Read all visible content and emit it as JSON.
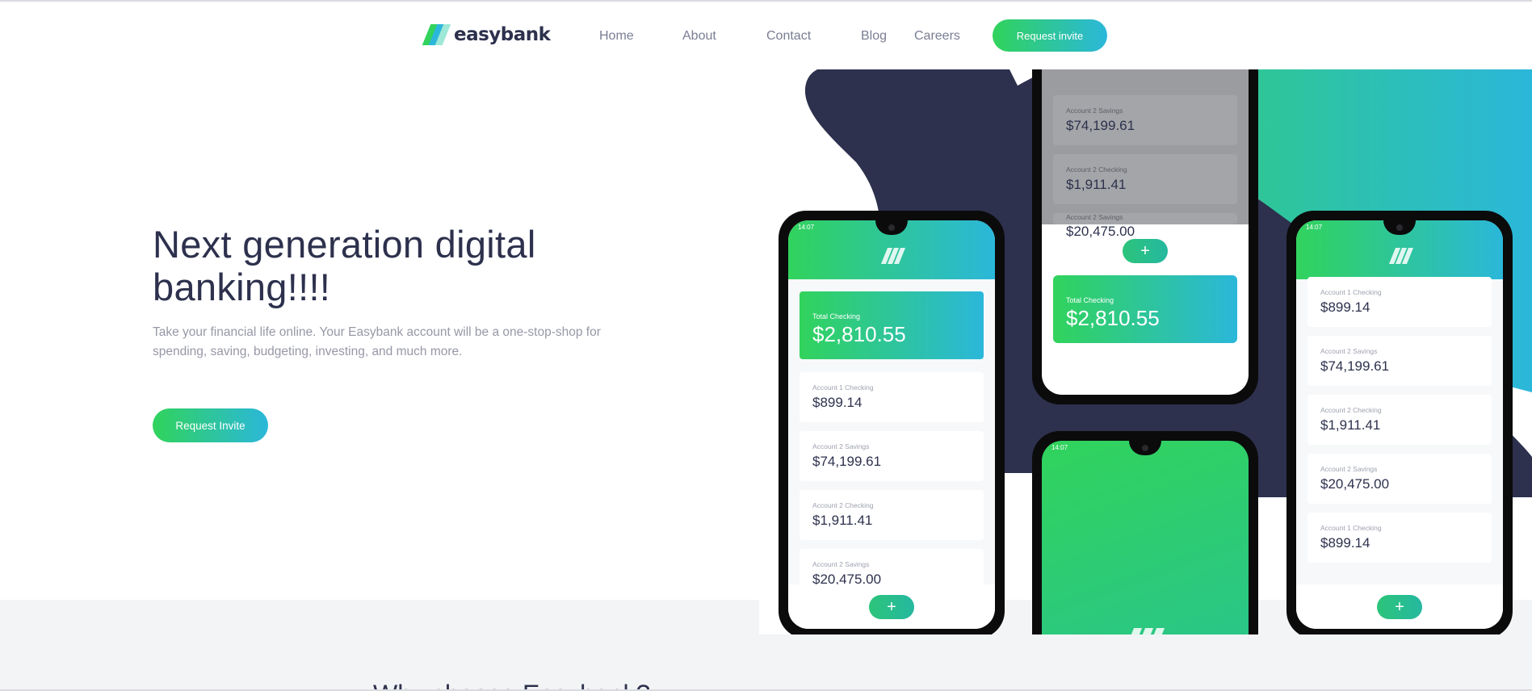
{
  "brand": {
    "name": "easybank",
    "colors": {
      "green": "#31d35c",
      "cyan": "#2bb7da",
      "navy": "#2d314d",
      "gray": "#9698a6"
    }
  },
  "nav": {
    "links": [
      "Home",
      "About",
      "Contact",
      "Blog",
      "Careers"
    ],
    "cta": "Request invite"
  },
  "hero": {
    "title": "Next generation digital banking!!!!",
    "subtitle": "Take your financial life online. Your Easybank account will be a one-stop-shop for spending, saving, budgeting, investing, and much more.",
    "cta": "Request Invite"
  },
  "phones": {
    "time": "14:07",
    "total_label": "Total Checking",
    "total_value": "$2,810.55",
    "add_icon": "plus-icon",
    "phone_left": [
      {
        "label": "Account 1 Checking",
        "value": "$899.14"
      },
      {
        "label": "Account 2 Savings",
        "value": "$74,199.61"
      },
      {
        "label": "Account 2 Checking",
        "value": "$1,911.41"
      },
      {
        "label": "Account 2 Savings",
        "value": "$20,475.00"
      }
    ],
    "phone_top": [
      {
        "label": "Account 2 Savings",
        "value": "$74,199.61"
      },
      {
        "label": "Account 2 Checking",
        "value": "$1,911.41"
      },
      {
        "label": "Account 2 Savings",
        "value": "$20,475.00"
      }
    ],
    "phone_right": [
      {
        "label": "Account 1 Checking",
        "value": "$899.14"
      },
      {
        "label": "Account 2 Savings",
        "value": "$74,199.61"
      },
      {
        "label": "Account 2 Checking",
        "value": "$1,911.41"
      },
      {
        "label": "Account 2 Savings",
        "value": "$20,475.00"
      },
      {
        "label": "Account 1 Checking",
        "value": "$899.14"
      }
    ]
  },
  "section2": {
    "title": "Why choose Easybank?"
  }
}
